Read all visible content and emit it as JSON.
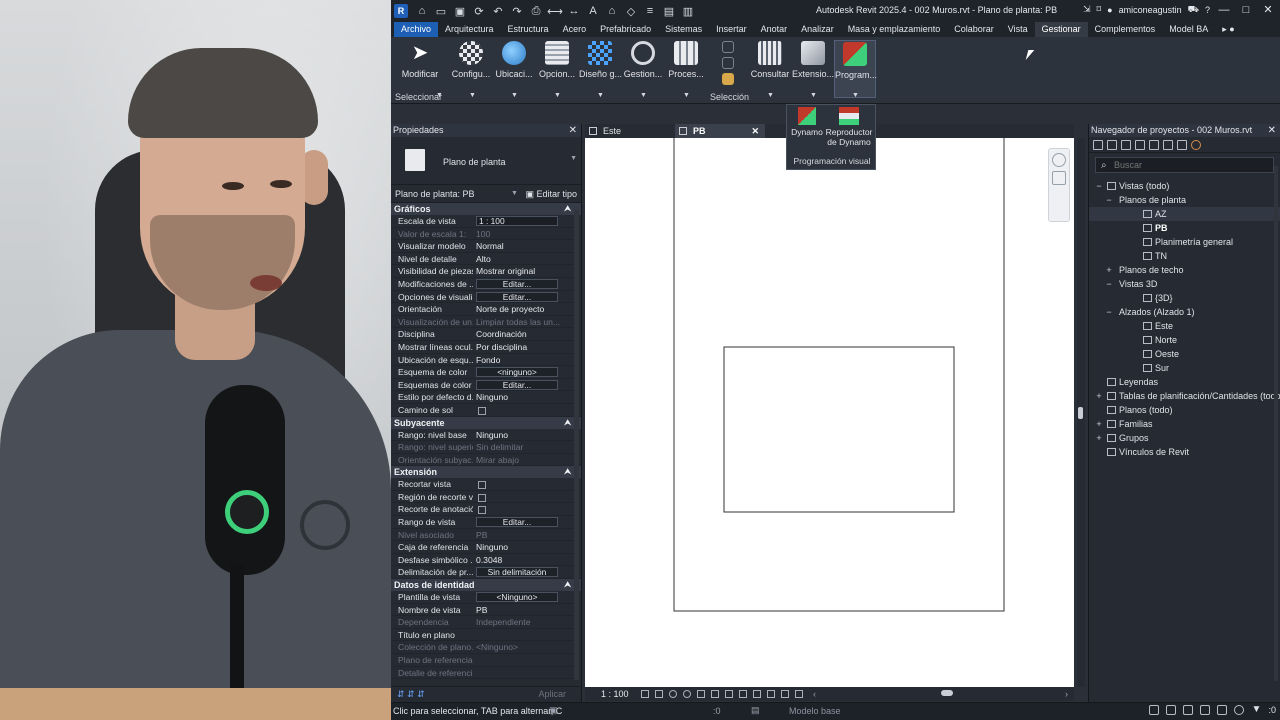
{
  "window": {
    "title": "Autodesk Revit 2025.4 - 002 Muros.rvt - Plano de planta: PB",
    "user": "amiconeagustin",
    "app_badge": "R"
  },
  "menu": {
    "tabs": [
      "Archivo",
      "Arquitectura",
      "Estructura",
      "Acero",
      "Prefabricado",
      "Sistemas",
      "Insertar",
      "Anotar",
      "Analizar",
      "Masa y emplazamiento",
      "Colaborar",
      "Vista",
      "Gestionar",
      "Complementos",
      "Model BA"
    ],
    "active_tab": "Gestionar"
  },
  "ribbon": {
    "buttons": [
      "Modificar",
      "Configu...",
      "Ubicaci...",
      "Opcion...",
      "Diseño g...",
      "Gestion...",
      "Proces...",
      "Consultar",
      "Extensio...",
      "Program..."
    ],
    "groups": [
      "Seleccionar",
      "Selección"
    ],
    "dynamo_panel": {
      "dynamo": "Dynamo",
      "player": "Reproductor de Dynamo",
      "caption": "Programación visual"
    },
    "colors": {
      "accent": "#1c5fb5",
      "dynamo_red": "#c0392b",
      "dynamo_green": "#3ecf7a"
    }
  },
  "properties": {
    "title": "Propiedades",
    "type_name": "Plano de planta",
    "instance_label": "Plano de planta: PB",
    "edit_type": "Editar tipo",
    "apply": "Aplicar",
    "sections": [
      {
        "name": "Gráficos",
        "rows": [
          {
            "n": "Escala de vista",
            "v": "1 : 100",
            "kind": "input"
          },
          {
            "n": "Valor de escala  1:",
            "v": "100",
            "dim": true
          },
          {
            "n": "Visualizar modelo",
            "v": "Normal"
          },
          {
            "n": "Nivel de detalle",
            "v": "Alto"
          },
          {
            "n": "Visibilidad de piezas",
            "v": "Mostrar original"
          },
          {
            "n": "Modificaciones de ...",
            "v": "Editar...",
            "kind": "button"
          },
          {
            "n": "Opciones de visuali...",
            "v": "Editar...",
            "kind": "button"
          },
          {
            "n": "Orientación",
            "v": "Norte de proyecto"
          },
          {
            "n": "Visualización de un...",
            "v": "Limpiar todas las un...",
            "dim": true
          },
          {
            "n": "Disciplina",
            "v": "Coordinación"
          },
          {
            "n": "Mostrar líneas ocul...",
            "v": "Por disciplina"
          },
          {
            "n": "Ubicación de esqu...",
            "v": "Fondo"
          },
          {
            "n": "Esquema de color",
            "v": "<ninguno>",
            "kind": "button"
          },
          {
            "n": "Esquemas de color ...",
            "v": "Editar...",
            "kind": "button"
          },
          {
            "n": "Estilo por defecto d...",
            "v": "Ninguno"
          },
          {
            "n": "Camino de sol",
            "v": "",
            "kind": "check"
          }
        ]
      },
      {
        "name": "Subyacente",
        "rows": [
          {
            "n": "Rango: nivel base",
            "v": "Ninguno"
          },
          {
            "n": "Rango: nivel superior",
            "v": "Sin delimitar",
            "dim": true
          },
          {
            "n": "Orientación subyac...",
            "v": "Mirar abajo",
            "dim": true
          }
        ]
      },
      {
        "name": "Extensión",
        "rows": [
          {
            "n": "Recortar vista",
            "v": "",
            "kind": "check"
          },
          {
            "n": "Región de recorte v...",
            "v": "",
            "kind": "check"
          },
          {
            "n": "Recorte de anotación",
            "v": "",
            "kind": "check"
          },
          {
            "n": "Rango de vista",
            "v": "Editar...",
            "kind": "button"
          },
          {
            "n": "Nivel asociado",
            "v": "PB",
            "dim": true
          },
          {
            "n": "Caja de referencia",
            "v": "Ninguno"
          },
          {
            "n": "Desfase simbólico ...",
            "v": "0.3048"
          },
          {
            "n": "Delimitación de pr...",
            "v": "Sin delimitación",
            "kind": "button"
          }
        ]
      },
      {
        "name": "Datos de identidad",
        "rows": [
          {
            "n": "Plantilla de vista",
            "v": "<Ninguno>",
            "kind": "button"
          },
          {
            "n": "Nombre de vista",
            "v": "PB"
          },
          {
            "n": "Dependencia",
            "v": "Independiente",
            "dim": true
          },
          {
            "n": "Título en plano",
            "v": ""
          },
          {
            "n": "Colección de plano...",
            "v": "<Ninguno>",
            "dim": true
          },
          {
            "n": "Plano de referencia",
            "v": "",
            "dim": true
          },
          {
            "n": "Detalle de referencia",
            "v": "",
            "dim": true
          }
        ]
      }
    ]
  },
  "view": {
    "tabs": [
      {
        "label": "Este",
        "active": false
      },
      {
        "label": "PB",
        "active": true
      }
    ],
    "scale": "1 : 100"
  },
  "browser": {
    "title": "Navegador de proyectos - 002 Muros.rvt",
    "search_placeholder": "Buscar",
    "tree": [
      {
        "label": "Vistas (todo)",
        "level": 0,
        "tog": "−",
        "icon": true
      },
      {
        "label": "Planos de planta",
        "level": 1,
        "tog": "−"
      },
      {
        "label": "AZ",
        "level": 2,
        "icon": true,
        "selected": true
      },
      {
        "label": "PB",
        "level": 2,
        "icon": true,
        "bold": true
      },
      {
        "label": "Planimetría general",
        "level": 2,
        "icon": true
      },
      {
        "label": "TN",
        "level": 2,
        "icon": true
      },
      {
        "label": "Planos de techo",
        "level": 1,
        "tog": "+"
      },
      {
        "label": "Vistas 3D",
        "level": 1,
        "tog": "−"
      },
      {
        "label": "{3D}",
        "level": 2,
        "icon": true
      },
      {
        "label": "Alzados (Alzado 1)",
        "level": 1,
        "tog": "−"
      },
      {
        "label": "Este",
        "level": 2,
        "icon": true
      },
      {
        "label": "Norte",
        "level": 2,
        "icon": true
      },
      {
        "label": "Oeste",
        "level": 2,
        "icon": true
      },
      {
        "label": "Sur",
        "level": 2,
        "icon": true
      },
      {
        "label": "Leyendas",
        "level": 0,
        "icon": true
      },
      {
        "label": "Tablas de planificación/Cantidades (todo)",
        "level": 0,
        "tog": "+",
        "icon": true
      },
      {
        "label": "Planos (todo)",
        "level": 0,
        "icon": true
      },
      {
        "label": "Familias",
        "level": 0,
        "tog": "+",
        "icon": true
      },
      {
        "label": "Grupos",
        "level": 0,
        "tog": "+",
        "icon": true
      },
      {
        "label": "Vínculos de Revit",
        "level": 0,
        "icon": true
      }
    ]
  },
  "status": {
    "hint": "Clic para seleccionar, TAB para alternar, C",
    "counter": ":0",
    "model": "Modelo base",
    "filter_count": ":0"
  }
}
